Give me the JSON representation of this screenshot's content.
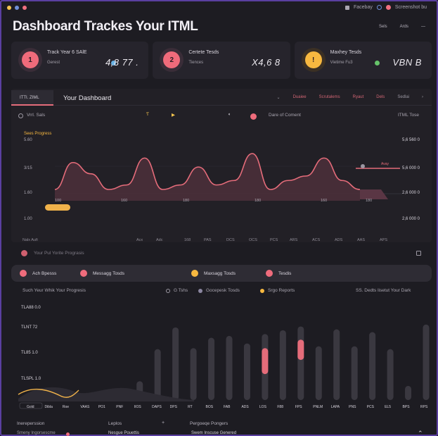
{
  "window": {
    "dots": [
      "#f6c550",
      "#6f8fd8",
      "#f27080"
    ],
    "right_items": [
      "Facebay",
      "Screenshot bu"
    ]
  },
  "header": {
    "title": "Dashboard Trackes Your ITML",
    "actions": [
      "Sels",
      "Ards",
      "—"
    ]
  },
  "cards": [
    {
      "icon": "1",
      "title": "Track Year 6 SAlE",
      "subtitle": "Gerest",
      "value": "4,8 77 .",
      "accent": "#f06b7b",
      "dot_color": "#69b3e6"
    },
    {
      "icon": "2",
      "title": "Certete Tesds",
      "subtitle": "Tiences",
      "value": "X4,6 8",
      "accent": "#f06b7b",
      "dot_color": ""
    },
    {
      "icon": "!",
      "title": "Maxhey Tesds",
      "subtitle": "Vietime Fu3",
      "value": "VBN B",
      "accent": "#f7b840",
      "dot_color": "#66c36a"
    }
  ],
  "panel": {
    "tab_active": "ITTI. ZIML",
    "tab_main": "Your Dashboard",
    "links": [
      "Duaiee",
      "Scrutalems",
      "Ryaut",
      "Dels",
      "Sedlai"
    ],
    "subrow": {
      "left": "Vrrl. Sals",
      "center": "Dare of Coment",
      "right": "ITML Tose"
    },
    "series_label": "Sees Progress",
    "button_label": "",
    "extra_label": "",
    "bottom_label": "Your Pul Yorite Prograsis"
  },
  "chart_data": [
    {
      "type": "area",
      "title": "",
      "series": [
        {
          "name": "Sees Progress",
          "values": [
            1.0,
            1.6,
            1.35,
            1.0,
            1.1,
            1.7,
            1.0,
            1.1,
            1.5,
            1.1,
            1.2,
            1.8,
            1.0,
            1.2,
            1.3,
            1.7,
            1.2,
            1.0
          ]
        }
      ],
      "y_ticks_left": [
        "5.60",
        "3/15",
        "1.60",
        "1.00"
      ],
      "y_ticks_right": [
        "5,6 560 0",
        "5,6 000 0",
        "2,6 000 0",
        "2,6 000 0"
      ],
      "x_ticks": [
        "100",
        "160",
        "180",
        "180",
        "160",
        "180",
        "180"
      ],
      "x_ticks_bottom": [
        "Nalx Aufi",
        "Acx",
        "Adc",
        "168",
        "PAS",
        "DCS",
        "OCS",
        "PCS",
        "ARS",
        "ACS",
        "ADS",
        "AAS",
        "APS"
      ],
      "highlight_value": "Avay"
    },
    {
      "type": "bar",
      "title": "",
      "y_ticks": [
        "TLA88 0.0",
        "TLNT 72",
        "TL85 1.0",
        "TLSPL 1.0"
      ],
      "categories": [
        "Gold",
        "Dibla",
        "Roe",
        "VAAS",
        "PO1",
        "PNF",
        "IIOS",
        "DAPS",
        "DPS",
        "RT",
        "BOS",
        "FAB",
        "ADS",
        "LOS",
        "F88",
        "FPS",
        "PNLM",
        "LAPA",
        "PNS",
        "PCS",
        "EL5",
        "BPS",
        "RPS"
      ],
      "values": [
        0.08,
        0.05,
        0.1,
        0.05,
        0.06,
        0.1,
        0.2,
        0.54,
        0.77,
        0.55,
        0.66,
        0.68,
        0.6,
        0.7,
        0.74,
        0.78,
        0.57,
        0.75,
        0.57,
        0.72,
        0.54,
        0.15,
        0.8
      ],
      "highlight_values": [
        0.55,
        0.64
      ],
      "line_values": [
        0.22,
        0.38,
        0.33,
        0.21,
        0.3,
        0.33,
        0.3
      ]
    }
  ],
  "pills": [
    {
      "label": "Ach Bpesss",
      "color": "#ef6c7c"
    },
    {
      "label": "Messagg Tosds",
      "color": "#ef6c7c"
    },
    {
      "label": "Maxsagg Tosds",
      "color": "#f7b840"
    },
    {
      "label": "Tesdis",
      "color": "#ef6c7c"
    }
  ],
  "legend": {
    "left": "Such Yeur Whik Your Progresis",
    "items": [
      {
        "label": "G Tshs",
        "color": "#9b97a2"
      },
      {
        "label": "Gocepesk Tosds",
        "color": "#8b86a0"
      },
      {
        "label": "Srgo Reports",
        "color": "#f7b840"
      }
    ],
    "right": "SS. Dedts lisetut Your Dark"
  },
  "footer": {
    "col1_title": "Inereperssion",
    "col1_sub": "Smeny Ingorsescme",
    "col2_title": "Leplos",
    "col2_sub": "Nesgue Pouettis",
    "col3_title": "Pergoeqe Pongers",
    "col3_sub": "Swem Inscuse Genered"
  }
}
